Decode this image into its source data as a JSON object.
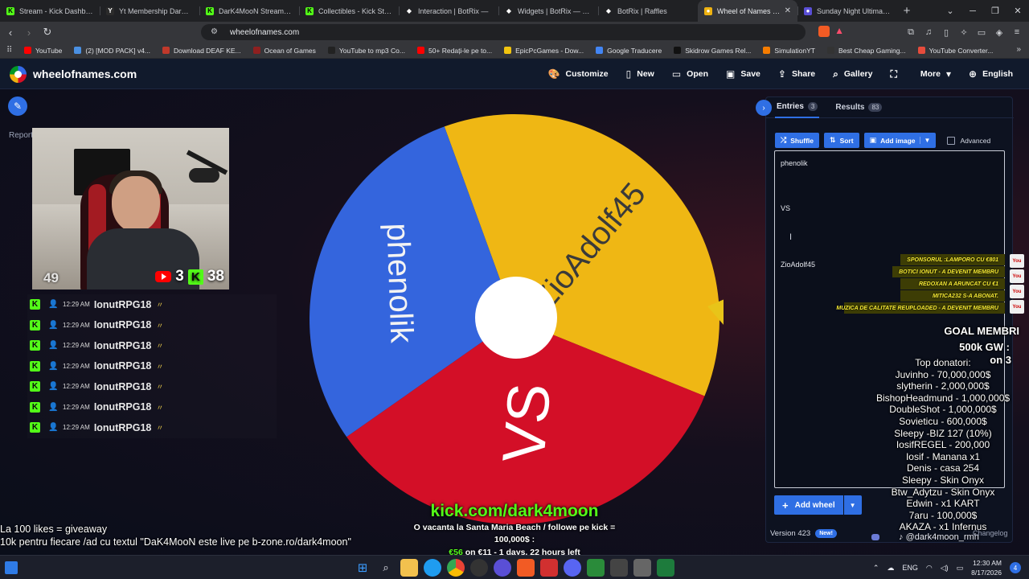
{
  "browser": {
    "tabs": [
      {
        "title": "Stream - Kick Dashboard",
        "fav": "K",
        "color": "#53fc18",
        "active": false
      },
      {
        "title": "Yt Membership DarK4MoO",
        "fav": "Y",
        "color": "#2b2b2b",
        "active": false
      },
      {
        "title": "DarK4MooN Stream - Wa",
        "fav": "K",
        "color": "#53fc18",
        "active": false
      },
      {
        "title": "Collectibles - Kick Stream",
        "fav": "K",
        "color": "#53fc18",
        "active": false
      },
      {
        "title": "Interaction | BotRix —",
        "fav": "◆",
        "color": "#202124",
        "active": false
      },
      {
        "title": "Widgets | BotRix — Cloud",
        "fav": "◆",
        "color": "#202124",
        "active": false
      },
      {
        "title": "BotRix | Raffles",
        "fav": "◆",
        "color": "#202124",
        "active": false
      },
      {
        "title": "Wheel of Names | Ra",
        "fav": "●",
        "color": "#eeb211",
        "active": true
      },
      {
        "title": "Sunday Night Ultimate Le",
        "fav": "●",
        "color": "#5a4fd6",
        "active": false
      }
    ],
    "url": "wheelofnames.com",
    "bookmarks": [
      {
        "label": "YouTube",
        "color": "#ff0000"
      },
      {
        "label": "(2) [MOD PACK] v4...",
        "color": "#4a90e2"
      },
      {
        "label": "Download DEAF KE...",
        "color": "#c0392b"
      },
      {
        "label": "Ocean of Games",
        "color": "#8e2020"
      },
      {
        "label": "YouTube to mp3 Co...",
        "color": "#222222"
      },
      {
        "label": "50+ Redați-le pe to...",
        "color": "#ff0000"
      },
      {
        "label": "EpicPcGames - Dow...",
        "color": "#f1c40f"
      },
      {
        "label": "Google Traducere",
        "color": "#4285f4"
      },
      {
        "label": "Skidrow Games Rel...",
        "color": "#111111"
      },
      {
        "label": "SimulationYT",
        "color": "#f57c00"
      },
      {
        "label": "Best Cheap Gaming...",
        "color": "#333333"
      },
      {
        "label": "YouTube Converter...",
        "color": "#e74c3c"
      }
    ]
  },
  "site": {
    "logo": "wheelofnames.com",
    "menu": [
      {
        "label": "Customize",
        "icon": "palette-icon",
        "glyph": "🎨"
      },
      {
        "label": "New",
        "icon": "file-icon",
        "glyph": "▯"
      },
      {
        "label": "Open",
        "icon": "folder-icon",
        "glyph": "▭"
      },
      {
        "label": "Save",
        "icon": "save-icon",
        "glyph": "▣"
      },
      {
        "label": "Share",
        "icon": "share-icon",
        "glyph": "⇪"
      },
      {
        "label": "Gallery",
        "icon": "search-icon",
        "glyph": "⌕"
      },
      {
        "label": "",
        "icon": "fullscreen-icon",
        "glyph": "⛶"
      },
      {
        "label": "More",
        "icon": "chevron-down-icon",
        "glyph": "▾"
      },
      {
        "label": "English",
        "icon": "globe-icon",
        "glyph": "⊕"
      }
    ],
    "report": "Report"
  },
  "stream": {
    "cam_number": "49",
    "youtube_count": "3",
    "kick_count": "38",
    "chat": [
      {
        "time": "12:29 AM",
        "user": "IonutRPG18"
      },
      {
        "time": "12:29 AM",
        "user": "IonutRPG18"
      },
      {
        "time": "12:29 AM",
        "user": "IonutRPG18"
      },
      {
        "time": "12:29 AM",
        "user": "IonutRPG18"
      },
      {
        "time": "12:29 AM",
        "user": "IonutRPG18"
      },
      {
        "time": "12:29 AM",
        "user": "IonutRPG18"
      },
      {
        "time": "12:29 AM",
        "user": "IonutRPG18"
      }
    ],
    "left_line1": "La 100 likes = giveaway",
    "left_line2": "10k pentru fiecare /ad cu textul \"DaK4MooN este live pe b-zone.ro/dark4moon\"",
    "kick_url": "kick.com/dark4moon",
    "promo_line1": "O vacanta la Santa Maria Beach / followe pe kick =",
    "promo_line2": "100,000$ :",
    "gw_amount": "€56",
    "gw_rest": " on €11 - 1 days, 22 hours left",
    "alerts": [
      "SPONSORUL :LAMPORO CU €801",
      "BOTICI IONUT - A DEVENIT MEMBRU",
      "REDOXAN A ARUNCAT CU €1",
      "MITICA232 S-A ABONAT.",
      "MUZICA DE CALITATE REUPLOADED - A DEVENIT MEMBRU"
    ],
    "goal_line1": "GOAL MEMBRI",
    "goal_line2": "500k GW :",
    "goal_line3": "on 3",
    "donors_title": "Top donatori:",
    "donors": [
      "Juvinho - 70,000,000$",
      "slytherin - 2,000,000$",
      "BishopHeadmund - 1,000,000$",
      "DoubleShot - 1,000,000$",
      "Sovieticu - 600,000$",
      "Sleepy -BIZ 127 (10%)",
      "IosifREGEL - 200,000",
      "Iosif - Manana x1",
      "Denis - casa 254",
      "Sleepy - Skin Onyx",
      "Btw_Adytzu - Skin Onyx",
      "Edwin - x1 KART",
      "7aru - 100,000$",
      "AKAZA - x1 Infernus"
    ],
    "tiktok": "@dark4moon_rmh",
    "changelog": "Changelog"
  },
  "wheel": {
    "segments": [
      {
        "label": "ZioAdolf45",
        "color": "#efb714",
        "start": -20,
        "end": 112
      },
      {
        "label": "VS",
        "color": "#d30f27",
        "start": 112,
        "end": 235
      },
      {
        "label": "phenolik",
        "color": "#3465dd",
        "start": 235,
        "end": 340
      }
    ]
  },
  "panel": {
    "entries_label": "Entries",
    "entries_count": "3",
    "results_label": "Results",
    "results_count": "83",
    "shuffle": "Shuffle",
    "sort": "Sort",
    "add_image": "Add image",
    "advanced": "Advanced",
    "entries": [
      "phenolik",
      "VS",
      "ZioAdolf45"
    ],
    "add_wheel": "Add wheel",
    "version": "Version 423",
    "new_badge": "New!"
  },
  "taskbar": {
    "lang": "ENG",
    "time": "12:30 AM",
    "date": "8/17/2026",
    "notifications": "4"
  }
}
